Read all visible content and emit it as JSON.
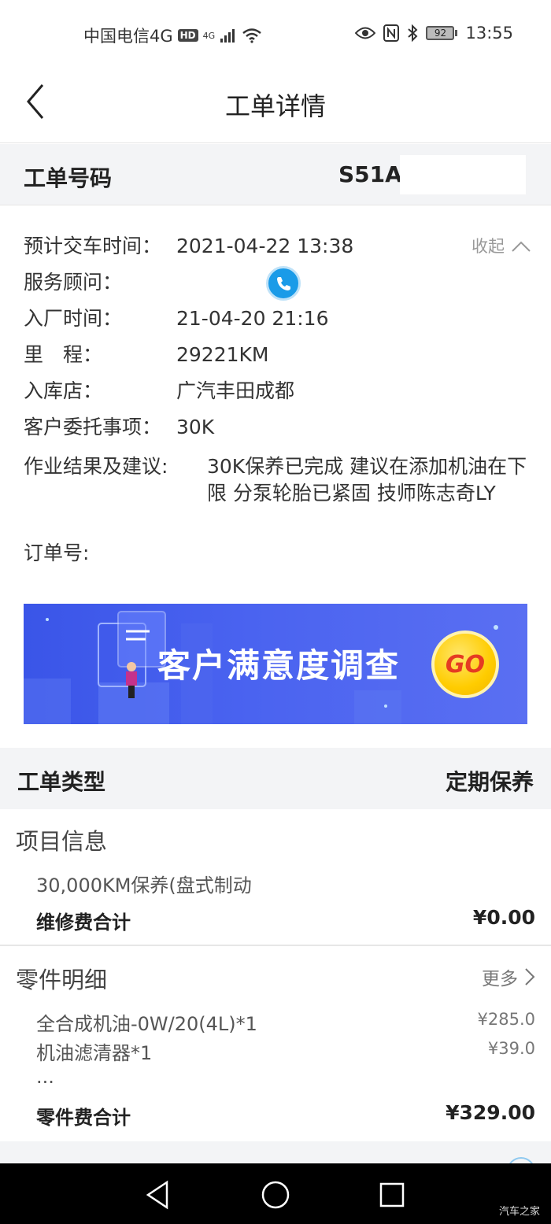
{
  "status_bar": {
    "carrier": "中国电信4G",
    "hd": "HD",
    "network": "4G",
    "battery": "92",
    "time": "13:55"
  },
  "nav": {
    "title": "工单详情"
  },
  "order": {
    "label": "工单号码",
    "value": "S51A"
  },
  "info": {
    "delivery_label": "预计交车时间：",
    "delivery_value": "2021-04-22 13:38",
    "collapse_label": "收起",
    "advisor_label": "服务顾问：",
    "entry_label": "入厂时间：",
    "entry_value": "21-04-20 21:16",
    "mileage_label": "里　程：",
    "mileage_value": "29221KM",
    "store_label": "入库店：",
    "store_value": "广汽丰田成都",
    "request_label": "客户委托事项：",
    "request_value": "30K",
    "result_label": "作业结果及建议:",
    "result_value": "30K保养已完成 建议在添加机油在下限 分泵轮胎已紧固 技师陈志奇LY",
    "order_no_label": "订单号:"
  },
  "banner": {
    "text": "客户满意度调查",
    "go": "GO"
  },
  "work_type": {
    "label": "工单类型",
    "value": "定期保养"
  },
  "project": {
    "title": "项目信息",
    "item": "30,000KM保养(盘式制动",
    "total_label": "维修费合计",
    "total_value": "¥0.00"
  },
  "parts": {
    "title": "零件明细",
    "more": "更多",
    "items": [
      {
        "name": "全合成机油-0W/20(4L)*1",
        "price": "¥285.0"
      },
      {
        "name": "机油滤清器*1",
        "price": "¥39.0"
      }
    ],
    "ellipsis": "...",
    "total_label": "零件费合计",
    "total_value": "¥329.00"
  },
  "watermark": "汽车之家",
  "colors": {
    "accent_blue": "#1a9be8",
    "banner_blue": "#4a63f0",
    "section_bg": "#f3f4f6"
  }
}
